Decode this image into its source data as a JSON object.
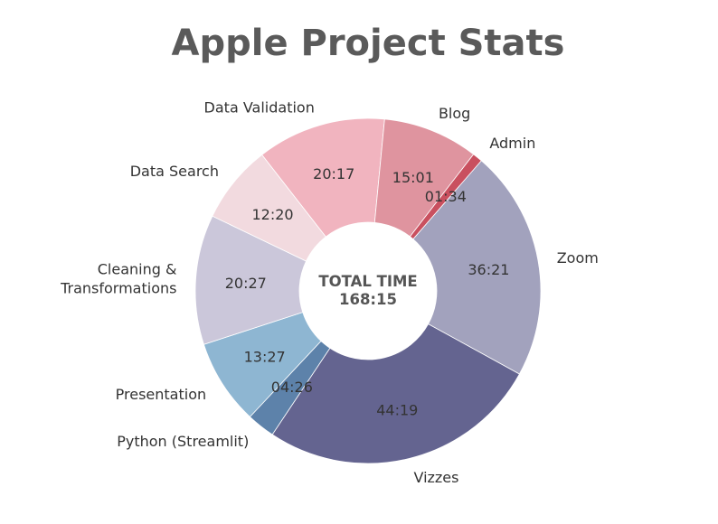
{
  "chart_data": {
    "type": "pie",
    "title": "Apple Project Stats",
    "center_label": [
      "TOTAL TIME",
      "168:15"
    ],
    "slices": [
      {
        "label": "Zoom",
        "value": "36:21",
        "minutes": 2181,
        "color": "#a2a2bd"
      },
      {
        "label": "Vizzes",
        "value": "44:19",
        "minutes": 2659,
        "color": "#646490"
      },
      {
        "label": "Python (Streamlit)",
        "value": "04:26",
        "minutes": 266,
        "color": "#5d82aa"
      },
      {
        "label": "Presentation",
        "value": "13:27",
        "minutes": 807,
        "color": "#8eb6d2"
      },
      {
        "label": "Cleaning & Transformations",
        "value": "20:27",
        "minutes": 1227,
        "color": "#cbc7da"
      },
      {
        "label": "Data Search",
        "value": "12:20",
        "minutes": 740,
        "color": "#f2dadf"
      },
      {
        "label": "Data Validation",
        "value": "20:17",
        "minutes": 1217,
        "color": "#f1b4bf"
      },
      {
        "label": "Blog",
        "value": "15:01",
        "minutes": 901,
        "color": "#df949f"
      },
      {
        "label": "Admin",
        "value": "01:34",
        "minutes": 94,
        "color": "#c9505f"
      }
    ]
  }
}
